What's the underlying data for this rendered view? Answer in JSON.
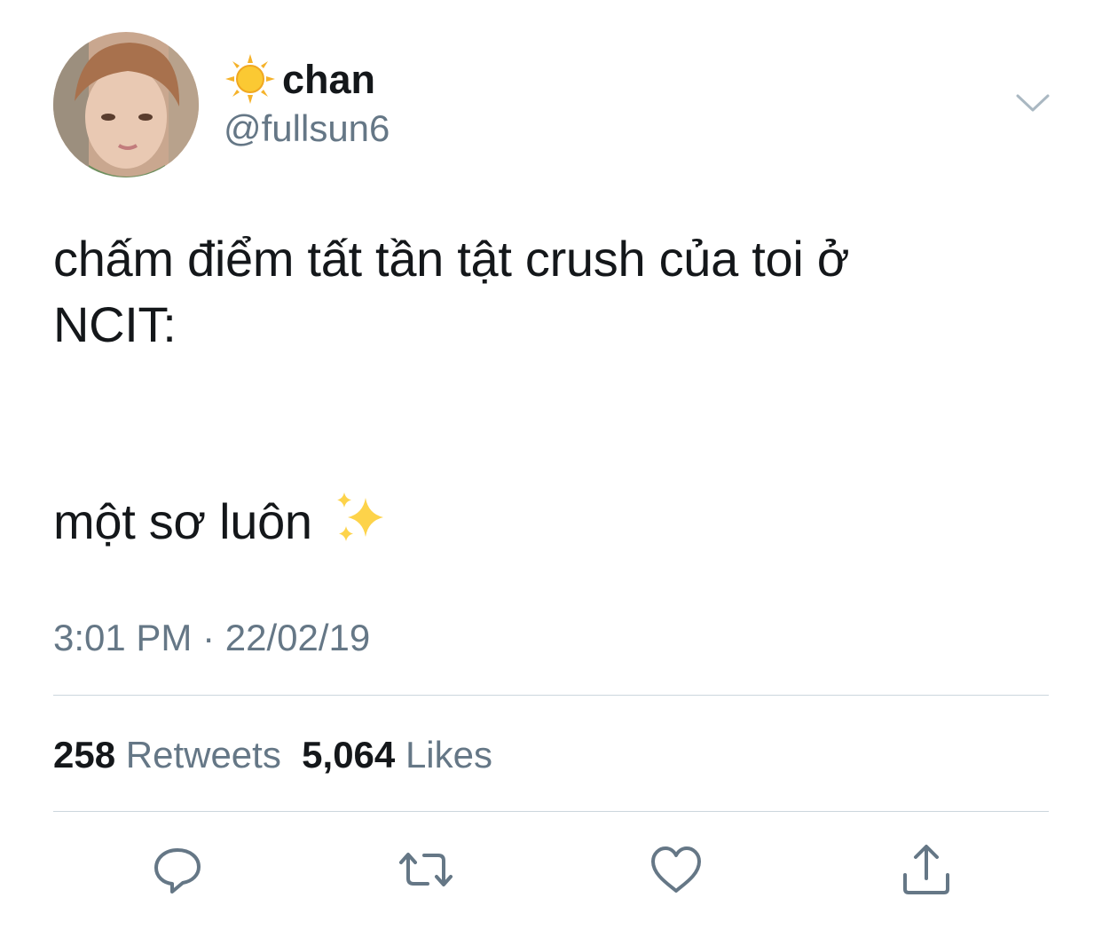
{
  "tweet": {
    "author": {
      "display_name": "chan",
      "handle": "@fullsun6",
      "name_emoji_icon": "sun-icon"
    },
    "text": {
      "line1": "chấm điểm tất tần tật crush của toi ở",
      "line2": "NCIT:",
      "line3": "một sơ luôn",
      "emoji_icon": "sparkles-icon"
    },
    "time": "3:01 PM",
    "separator": "·",
    "date": "22/02/19",
    "stats": {
      "retweets_count": "258",
      "retweets_label": "Retweets",
      "likes_count": "5,064",
      "likes_label": "Likes"
    },
    "actions": [
      "reply-icon",
      "retweet-icon",
      "like-icon",
      "share-icon"
    ]
  },
  "colors": {
    "text_primary": "#14171a",
    "text_secondary": "#657786",
    "divider": "#ccd6dd",
    "icon": "#657786"
  }
}
